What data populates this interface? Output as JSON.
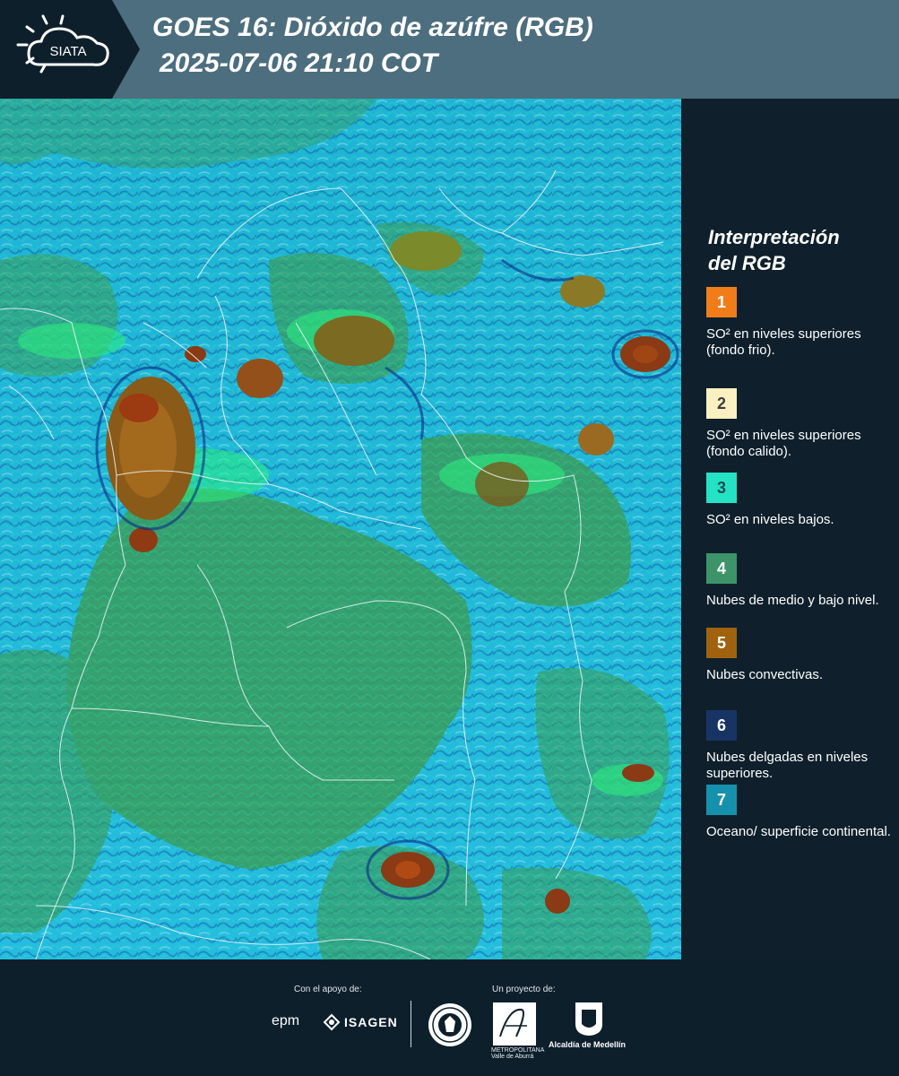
{
  "header": {
    "logo_text": "SIATA",
    "title_line1": "GOES 16: Dióxido de azúfre (RGB)",
    "title_line2": "2025-07-06 21:10 COT"
  },
  "legend": {
    "title_line1": "Interpretación",
    "title_line2": "del RGB",
    "items": [
      {
        "number": "1",
        "text": "SO² en niveles superiores (fondo frio).",
        "color": "#f07d1a",
        "num_color": "#ffffff"
      },
      {
        "number": "2",
        "text": "SO² en niveles superiores (fondo calido).",
        "color": "#fbf1c0",
        "num_color": "#3c3c3c"
      },
      {
        "number": "3",
        "text": "SO² en niveles bajos.",
        "color": "#24e3c4",
        "num_color": "#1e4a52"
      },
      {
        "number": "4",
        "text": "Nubes de medio y bajo nivel.",
        "color": "#3c9468",
        "num_color": "#ffffff"
      },
      {
        "number": "5",
        "text": "Nubes convectivas.",
        "color": "#a0620f",
        "num_color": "#ffffff"
      },
      {
        "number": "6",
        "text": "Nubes delgadas en niveles superiores.",
        "color": "#173465",
        "num_color": "#ffffff"
      },
      {
        "number": "7",
        "text": "Oceano/ superficie continental.",
        "color": "#1691ad",
        "num_color": "#ffffff"
      }
    ]
  },
  "footer": {
    "support_label": "Con el apoyo de:",
    "project_label": "Un proyecto de:",
    "sponsor1": "epm",
    "sponsor2": "ISAGEN",
    "partner1": "METROPOLITANA",
    "partner1_sub": "Valle de Aburrá",
    "partner2": "Alcaldía de Medellín"
  }
}
